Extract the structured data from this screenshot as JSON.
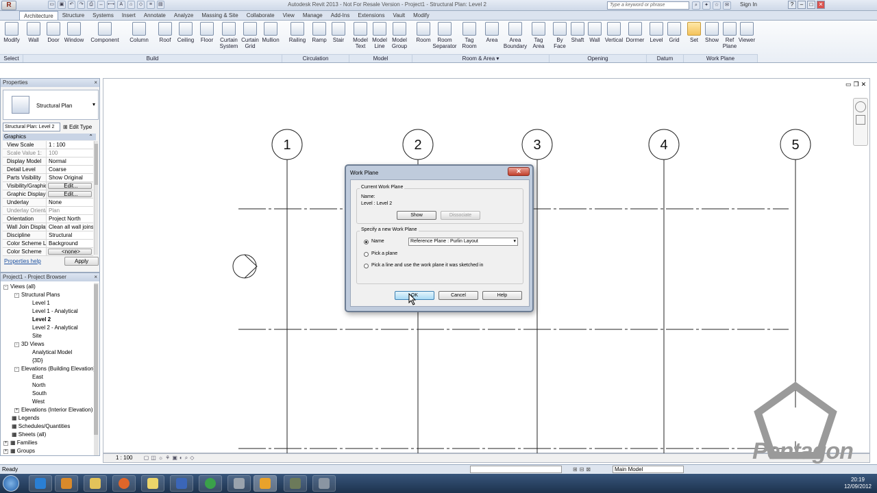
{
  "window": {
    "title": "Autodesk Revit 2013 - Not For Resale Version - Project1 - Structural Plan: Level 2",
    "search_placeholder": "Type a keyword or phrase",
    "sign_in": "Sign In"
  },
  "ribbon_tabs": [
    "Architecture",
    "Structure",
    "Systems",
    "Insert",
    "Annotate",
    "Analyze",
    "Massing & Site",
    "Collaborate",
    "View",
    "Manage",
    "Add-Ins",
    "Extensions",
    "Vault",
    "Modify"
  ],
  "ribbon_buttons": {
    "modify": "Modify",
    "wall": "Wall",
    "door": "Door",
    "window": "Window",
    "component": "Component",
    "column": "Column",
    "roof": "Roof",
    "ceiling": "Ceiling",
    "floor": "Floor",
    "curtain_system": "Curtain System",
    "curtain_grid": "Curtain Grid",
    "mullion": "Mullion",
    "railing": "Railing",
    "ramp": "Ramp",
    "stair": "Stair",
    "model_text": "Model Text",
    "model_line": "Model Line",
    "model_group": "Model Group",
    "room": "Room",
    "room_separator": "Room Separator",
    "tag_room": "Tag Room",
    "area": "Area",
    "area_boundary": "Area Boundary",
    "tag_area": "Tag Area",
    "by_face": "By Face",
    "shaft": "Shaft",
    "wall_opening": "Wall",
    "vertical": "Vertical",
    "dormer": "Dormer",
    "level": "Level",
    "grid": "Grid",
    "set": "Set",
    "show": "Show",
    "ref_plane": "Ref Plane",
    "viewer": "Viewer"
  },
  "ribbon_panels": {
    "select": "Select",
    "build": "Build",
    "circulation": "Circulation",
    "model": "Model",
    "room_area": "Room & Area",
    "opening": "Opening",
    "datum": "Datum",
    "work_plane": "Work Plane"
  },
  "properties": {
    "header": "Properties",
    "type_name": "Structural Plan",
    "filter": "Structural Plan: Level 2",
    "edit_type": "Edit Type",
    "group": "Graphics",
    "rows": [
      {
        "k": "View Scale",
        "v": "1 : 100"
      },
      {
        "k": "Scale Value 1:",
        "v": "100"
      },
      {
        "k": "Display Model",
        "v": "Normal"
      },
      {
        "k": "Detail Level",
        "v": "Coarse"
      },
      {
        "k": "Parts Visibility",
        "v": "Show Original"
      },
      {
        "k": "Visibility/Graphics Overrides",
        "v": "Edit..."
      },
      {
        "k": "Graphic Display Options",
        "v": "Edit..."
      },
      {
        "k": "Underlay",
        "v": "None"
      },
      {
        "k": "Underlay Orientation",
        "v": "Plan"
      },
      {
        "k": "Orientation",
        "v": "Project North"
      },
      {
        "k": "Wall Join Display",
        "v": "Clean all wall joins"
      },
      {
        "k": "Discipline",
        "v": "Structural"
      },
      {
        "k": "Color Scheme Location",
        "v": "Background"
      },
      {
        "k": "Color Scheme",
        "v": "<none>"
      }
    ],
    "help": "Properties help",
    "apply": "Apply"
  },
  "browser": {
    "header": "Project1 - Project Browser",
    "items": [
      {
        "label": "Views (all)",
        "exp": "-"
      },
      {
        "label": "Structural Plans",
        "exp": "-"
      },
      {
        "label": "Level 1",
        "exp": ""
      },
      {
        "label": "Level 1 - Analytical",
        "exp": ""
      },
      {
        "label": "Level 2",
        "exp": "",
        "bold": true
      },
      {
        "label": "Level 2 - Analytical",
        "exp": ""
      },
      {
        "label": "Site",
        "exp": ""
      },
      {
        "label": "3D Views",
        "exp": "-"
      },
      {
        "label": "Analytical Model",
        "exp": ""
      },
      {
        "label": "{3D}",
        "exp": ""
      },
      {
        "label": "Elevations (Building Elevation)",
        "exp": "-"
      },
      {
        "label": "East",
        "exp": ""
      },
      {
        "label": "North",
        "exp": ""
      },
      {
        "label": "South",
        "exp": ""
      },
      {
        "label": "West",
        "exp": ""
      },
      {
        "label": "Elevations (Interior Elevation)",
        "exp": "+"
      },
      {
        "label": "Legends",
        "exp": ""
      },
      {
        "label": "Schedules/Quantities",
        "exp": ""
      },
      {
        "label": "Sheets (all)",
        "exp": ""
      },
      {
        "label": "Families",
        "exp": "+"
      },
      {
        "label": "Groups",
        "exp": "+"
      }
    ]
  },
  "grids": [
    "1",
    "2",
    "3",
    "4",
    "5"
  ],
  "dialog": {
    "title": "Work Plane",
    "current_group": "Current Work Plane",
    "name_label": "Name:",
    "name_value": "Level : Level 2",
    "show": "Show",
    "dissociate": "Dissociate",
    "specify_group": "Specify a new Work Plane",
    "opt_name": "Name",
    "name_select": "Reference Plane : Purlin Layout",
    "opt_pick_plane": "Pick a plane",
    "opt_pick_line": "Pick a line and use the work plane it was sketched in",
    "ok": "OK",
    "cancel": "Cancel",
    "help": "Help"
  },
  "viewbar": {
    "scale": "1 : 100"
  },
  "status": {
    "text": "Ready",
    "model": "Main Model"
  },
  "clock": {
    "time": "20:19",
    "date": "12/09/2012"
  },
  "watermark": "Pentagon"
}
